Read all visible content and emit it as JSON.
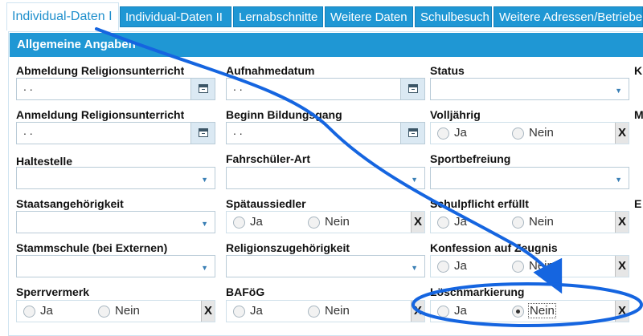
{
  "tabs": [
    {
      "label": "Individual-Daten I",
      "active": true
    },
    {
      "label": "Individual-Daten II",
      "active": false
    },
    {
      "label": "Lernabschnitte",
      "active": false
    },
    {
      "label": "Weitere Daten",
      "active": false
    },
    {
      "label": "Schulbesuch",
      "active": false
    },
    {
      "label": "Weitere Adressen/Betriebe",
      "active": false
    }
  ],
  "panel": {
    "title": "Allgemeine Angaben"
  },
  "fields": {
    "abmeldung_religion": {
      "label": "Abmeldung Religionsunterricht",
      "value": ".  ."
    },
    "aufnahmedatum": {
      "label": "Aufnahmedatum",
      "value": ".  ."
    },
    "status": {
      "label": "Status",
      "value": ""
    },
    "col4_row1": {
      "label": "K"
    },
    "anmeldung_religion": {
      "label": "Anmeldung Religionsunterricht",
      "value": ".  ."
    },
    "beginn_bildungsgang": {
      "label": "Beginn Bildungsgang",
      "value": ".  ."
    },
    "volljaehrig": {
      "label": "Volljährig",
      "ja": "Ja",
      "nein": "Nein",
      "clear": "X",
      "selected": null
    },
    "col4_row2": {
      "label": "M"
    },
    "haltestelle": {
      "label": "Haltestelle",
      "value": ""
    },
    "fahrschueler_art": {
      "label": "Fahrschüler-Art",
      "value": ""
    },
    "sportbefreiung": {
      "label": "Sportbefreiung",
      "value": ""
    },
    "staatsangehoerigkeit": {
      "label": "Staatsangehörigkeit",
      "value": ""
    },
    "spaetaussiedler": {
      "label": "Spätaussiedler",
      "ja": "Ja",
      "nein": "Nein",
      "clear": "X",
      "selected": null
    },
    "schulpflicht": {
      "label": "Schulpflicht erfüllt",
      "ja": "Ja",
      "nein": "Nein",
      "clear": "X",
      "selected": null
    },
    "col4_row4": {
      "label": "E"
    },
    "stammschule": {
      "label": "Stammschule (bei Externen)",
      "value": ""
    },
    "religionszugehoerigkeit": {
      "label": "Religionszugehörigkeit",
      "value": ""
    },
    "konfession_zeugnis": {
      "label": "Konfession auf Zeugnis",
      "ja": "Ja",
      "nein": "Nein",
      "clear": "X",
      "selected": null
    },
    "sperrvermerk": {
      "label": "Sperrvermerk",
      "ja": "Ja",
      "nein": "Nein",
      "clear": "X",
      "selected": null
    },
    "bafoeg": {
      "label": "BAFöG",
      "ja": "Ja",
      "nein": "Nein",
      "clear": "X",
      "selected": null
    },
    "loeschmarkierung": {
      "label": "Löschmarkierung",
      "ja": "Ja",
      "nein": "Nein",
      "clear": "X",
      "selected": "Nein"
    }
  },
  "colors": {
    "accent": "#1f97d4",
    "annotation": "#1565e0"
  },
  "icons": {
    "date_button": "calendar-icon",
    "dropdown": "chevron-down-icon"
  }
}
